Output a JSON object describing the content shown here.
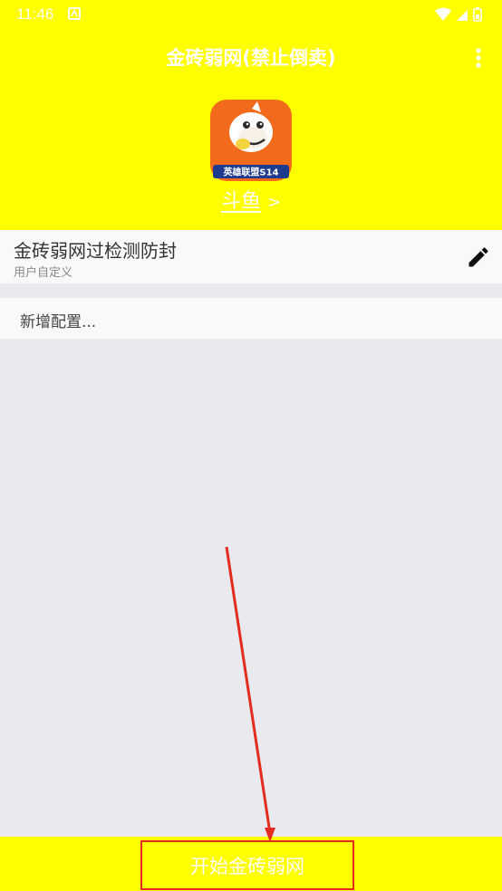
{
  "status_bar": {
    "time": "11:46",
    "icons": [
      "notification-icon",
      "wifi-icon",
      "signal-icon",
      "battery-icon"
    ]
  },
  "header": {
    "title": "金砖弱网(禁止倒卖)",
    "menu_icon": "more-vert-icon",
    "background_color": "#ffff00",
    "app": {
      "icon": "douyu-app-icon",
      "icon_banner_text": "英雄联盟S14",
      "name": "斗鱼",
      "chevron": ">"
    }
  },
  "profile": {
    "title": "金砖弱网过检测防封",
    "subtitle": "用户自定义",
    "edit_icon": "pencil-icon"
  },
  "add_config": {
    "label": "新增配置..."
  },
  "bottom": {
    "start_label": "开始金砖弱网",
    "highlight_color": "#e42b1f"
  }
}
